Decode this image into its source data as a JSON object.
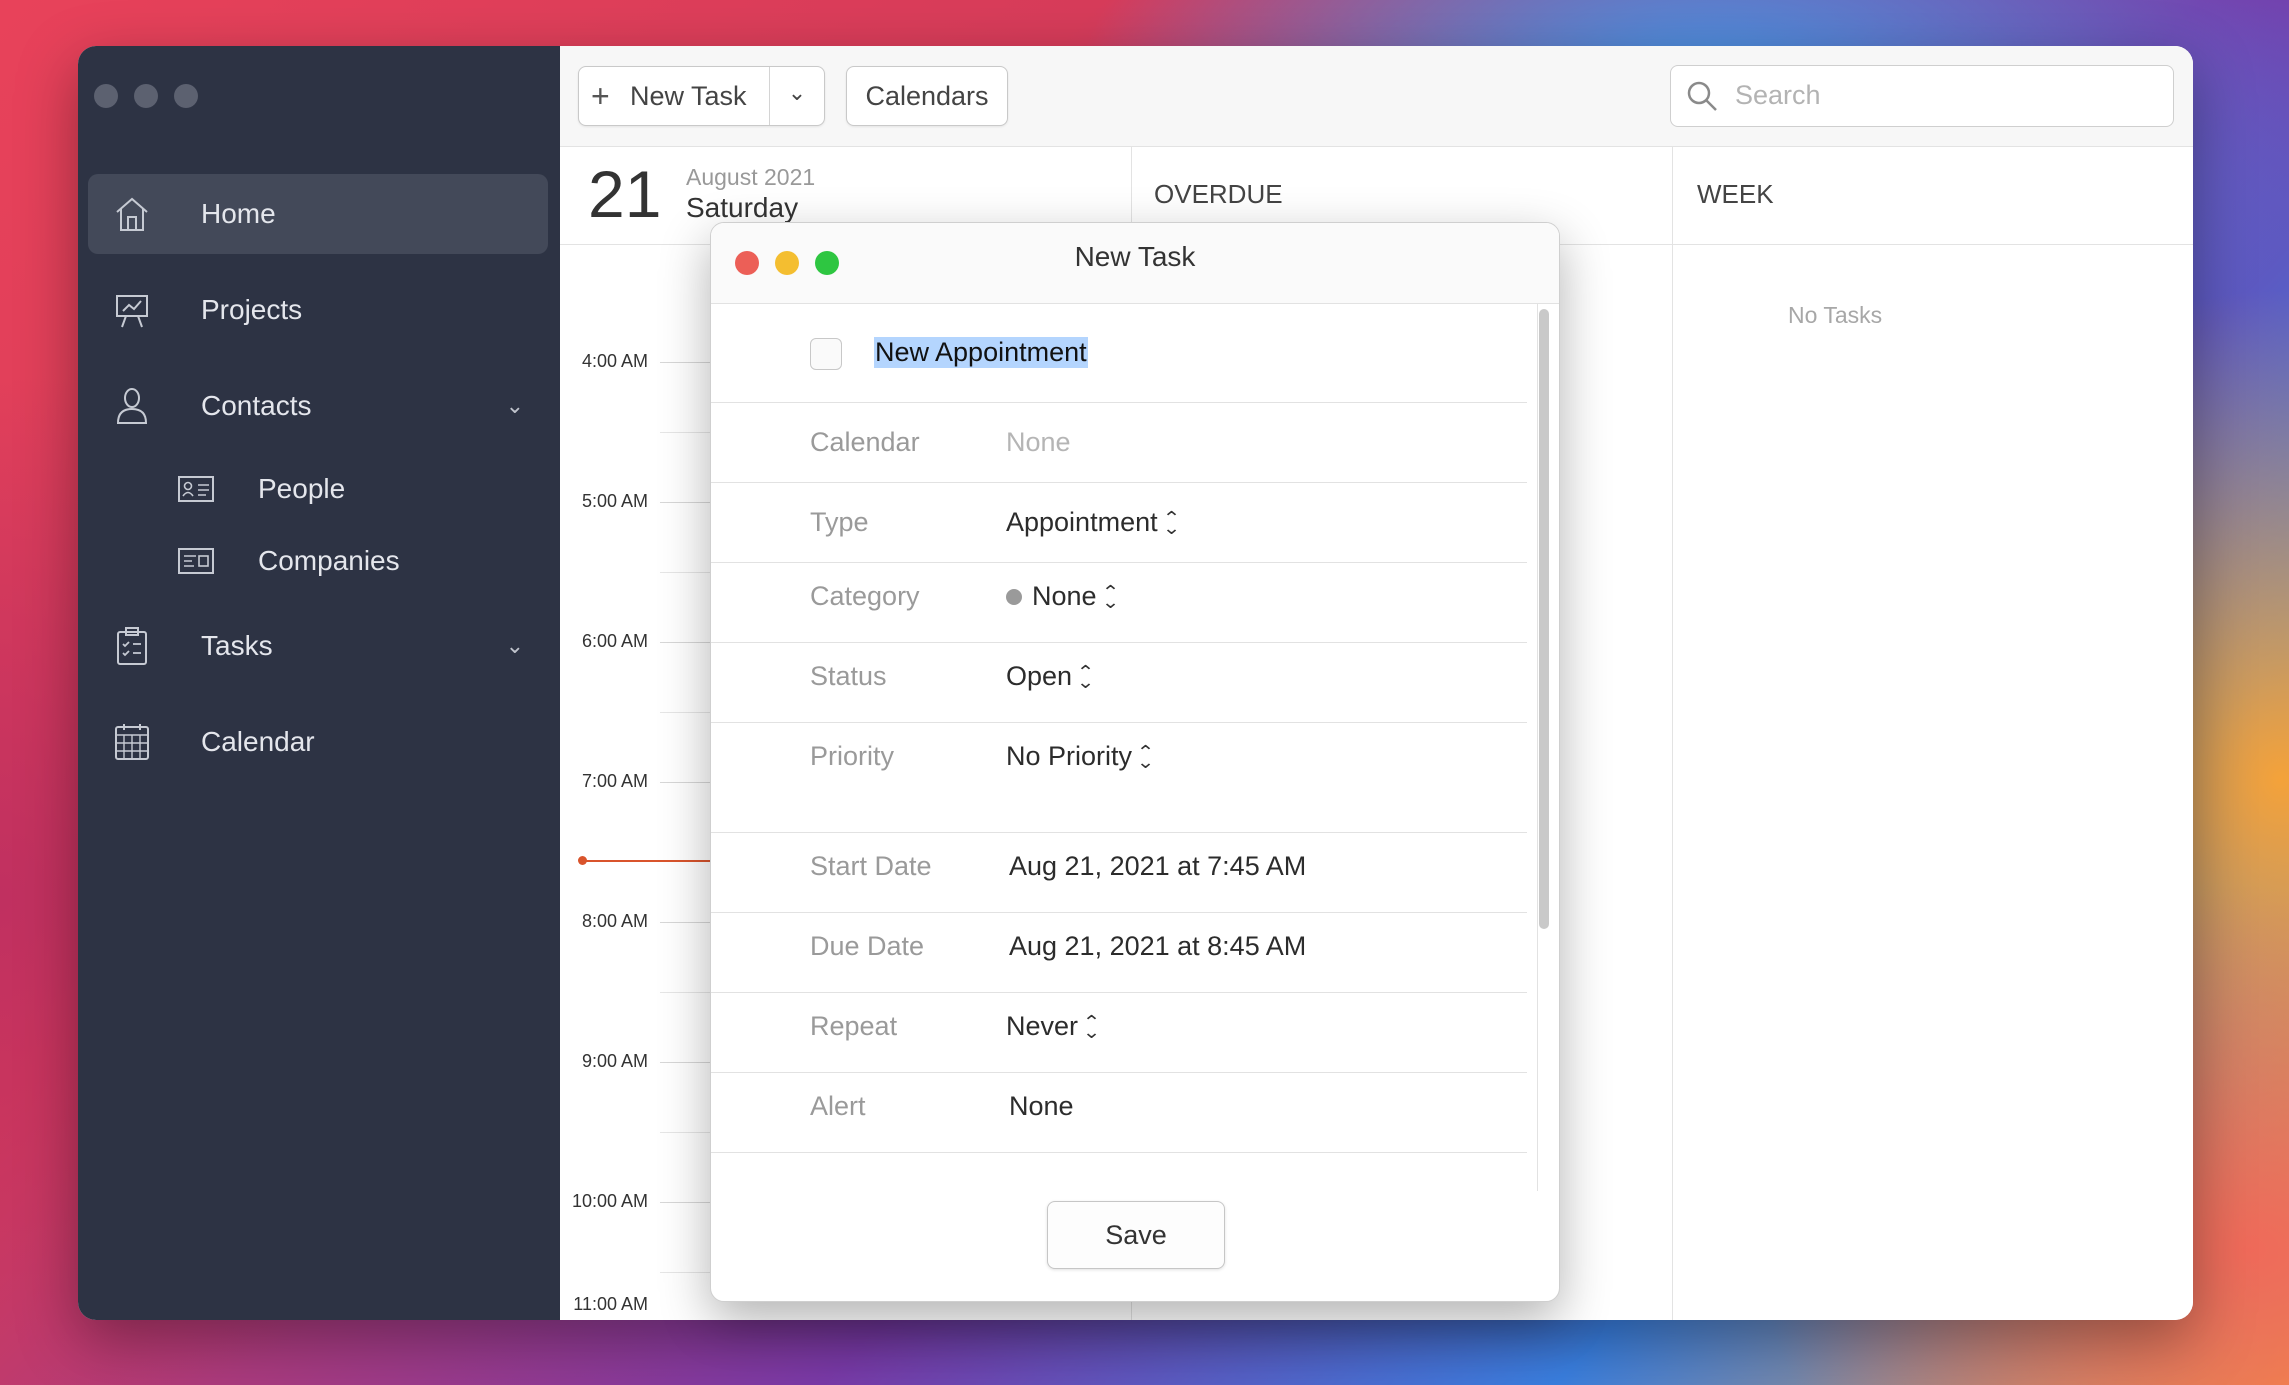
{
  "sidebar": {
    "items": [
      {
        "label": "Home",
        "icon": "home-icon"
      },
      {
        "label": "Projects",
        "icon": "presentation-icon"
      },
      {
        "label": "Contacts",
        "icon": "person-icon"
      },
      {
        "label": "Tasks",
        "icon": "clipboard-icon"
      },
      {
        "label": "Calendar",
        "icon": "calendar-grid-icon"
      }
    ],
    "sub_contacts": [
      {
        "label": "People",
        "icon": "id-card-icon"
      },
      {
        "label": "Companies",
        "icon": "business-card-icon"
      }
    ]
  },
  "toolbar": {
    "new_task_label": "New Task",
    "calendars_label": "Calendars",
    "search_placeholder": "Search"
  },
  "day": {
    "number": "21",
    "month_year": "August 2021",
    "weekday": "Saturday",
    "hours": [
      "4:00 AM",
      "5:00 AM",
      "6:00 AM",
      "7:00 AM",
      "8:00 AM",
      "9:00 AM",
      "10:00 AM",
      "11:00 AM"
    ]
  },
  "columns": {
    "overdue_title": "OVERDUE",
    "week_title": "WEEK",
    "week_empty": "No Tasks"
  },
  "dialog": {
    "title": "New Task",
    "task_name": "New Appointment",
    "rows": {
      "calendar": {
        "label": "Calendar",
        "value": "None"
      },
      "type": {
        "label": "Type",
        "value": "Appointment"
      },
      "category": {
        "label": "Category",
        "value": "None"
      },
      "status": {
        "label": "Status",
        "value": "Open"
      },
      "priority": {
        "label": "Priority",
        "value": "No Priority"
      },
      "start": {
        "label": "Start Date",
        "value": "Aug 21, 2021 at 7:45 AM"
      },
      "due": {
        "label": "Due Date",
        "value": "Aug 21, 2021 at 8:45 AM"
      },
      "repeat": {
        "label": "Repeat",
        "value": "Never"
      },
      "alert": {
        "label": "Alert",
        "value": "None"
      }
    },
    "save_label": "Save"
  },
  "colors": {
    "sidebar_bg": "#2d3344",
    "current_time_line": "#d9542c",
    "selection_highlight": "#b4d5fe",
    "close": "#ec5f57",
    "minimize": "#f4be30",
    "zoom": "#2ec641"
  }
}
